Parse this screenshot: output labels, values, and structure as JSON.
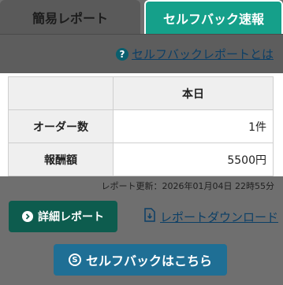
{
  "tabs": [
    {
      "label": "簡易レポート",
      "active": false
    },
    {
      "label": "セルフバック速報",
      "active": true
    }
  ],
  "help_link": {
    "label": "セルフバックレポートとは",
    "icon": "help-icon"
  },
  "table": {
    "column_header": "本日",
    "rows": [
      {
        "label": "オーダー数",
        "value": "1件"
      },
      {
        "label": "報酬額",
        "value": "5500円"
      }
    ]
  },
  "updated": "レポート更新：2026年01月04日 22時55分",
  "buttons": {
    "detail_label": "詳細レポート",
    "download_label": "レポートダウンロード",
    "selfback_label": "セルフバックはこちら"
  },
  "colors": {
    "active_tab": "#15a08a",
    "detail_button": "#0d5c4e",
    "selfback_button": "#1f6f95",
    "link": "#0c3f66"
  }
}
